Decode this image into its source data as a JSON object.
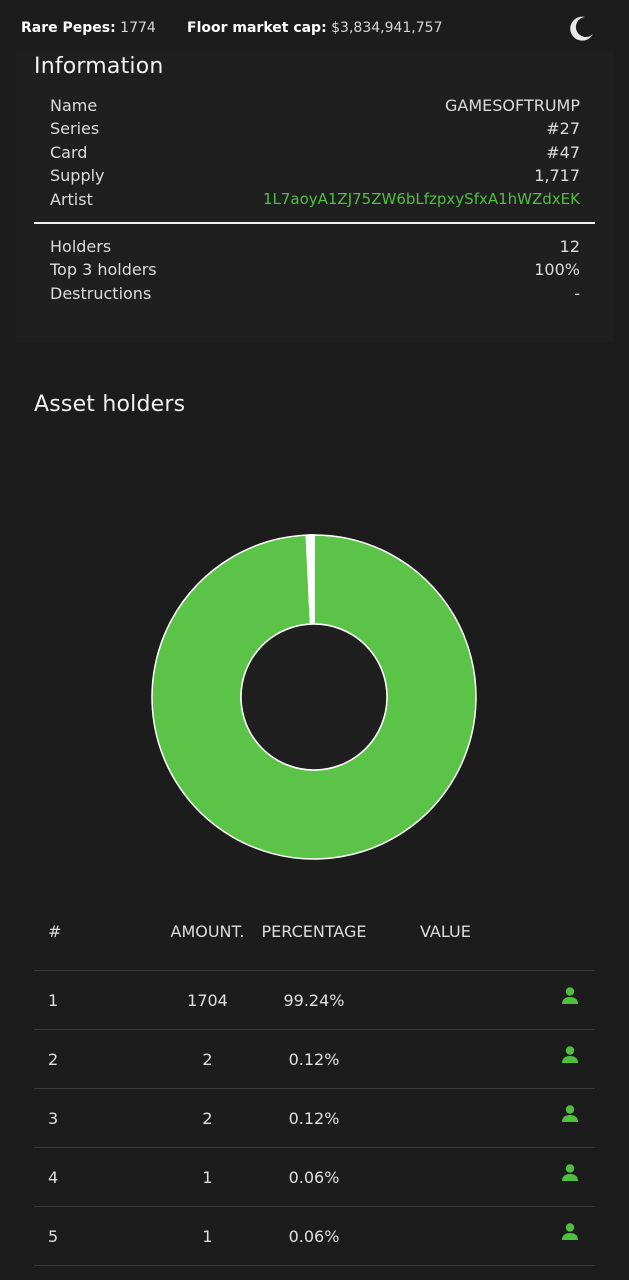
{
  "header": {
    "rare_pepes_label": "Rare Pepes:",
    "rare_pepes_value": "1774",
    "floor_cap_label": "Floor market cap:",
    "floor_cap_value": "$3,834,941,757",
    "theme_icon": "moon-icon"
  },
  "information": {
    "title": "Information",
    "rows": [
      {
        "label": "Name",
        "value": "GAMESOFTRUMP"
      },
      {
        "label": "Series",
        "value": "#27"
      },
      {
        "label": "Card",
        "value": "#47"
      },
      {
        "label": "Supply",
        "value": "1,717"
      },
      {
        "label": "Artist",
        "value": "1L7aoyA1ZJ75ZW6bLfzpxySfxA1hWZdxEK"
      }
    ],
    "stats": [
      {
        "label": "Holders",
        "value": "12"
      },
      {
        "label": "Top 3 holders",
        "value": "100%"
      },
      {
        "label": "Destructions",
        "value": "-"
      }
    ],
    "artist_color": "#4fbf40"
  },
  "asset_holders": {
    "title": "Asset holders",
    "chart_data": {
      "type": "pie",
      "donut": true,
      "values": [
        1704,
        2,
        2,
        1,
        1,
        1,
        1,
        1,
        1,
        1,
        1,
        1
      ],
      "colors": {
        "main": "#5bc448",
        "separator": "#ffffff",
        "hole": "#1f1f20"
      }
    },
    "table": {
      "headers": {
        "rank": "#",
        "amount": "AMOUNT.",
        "percentage": "PERCENTAGE",
        "value": "VALUE"
      },
      "rows": [
        {
          "rank": "1",
          "amount": "1704",
          "percentage": "99.24%",
          "icon": "user-icon"
        },
        {
          "rank": "2",
          "amount": "2",
          "percentage": "0.12%",
          "icon": "user-icon"
        },
        {
          "rank": "3",
          "amount": "2",
          "percentage": "0.12%",
          "icon": "user-icon"
        },
        {
          "rank": "4",
          "amount": "1",
          "percentage": "0.06%",
          "icon": "user-icon"
        },
        {
          "rank": "5",
          "amount": "1",
          "percentage": "0.06%",
          "icon": "user-icon"
        }
      ]
    }
  }
}
